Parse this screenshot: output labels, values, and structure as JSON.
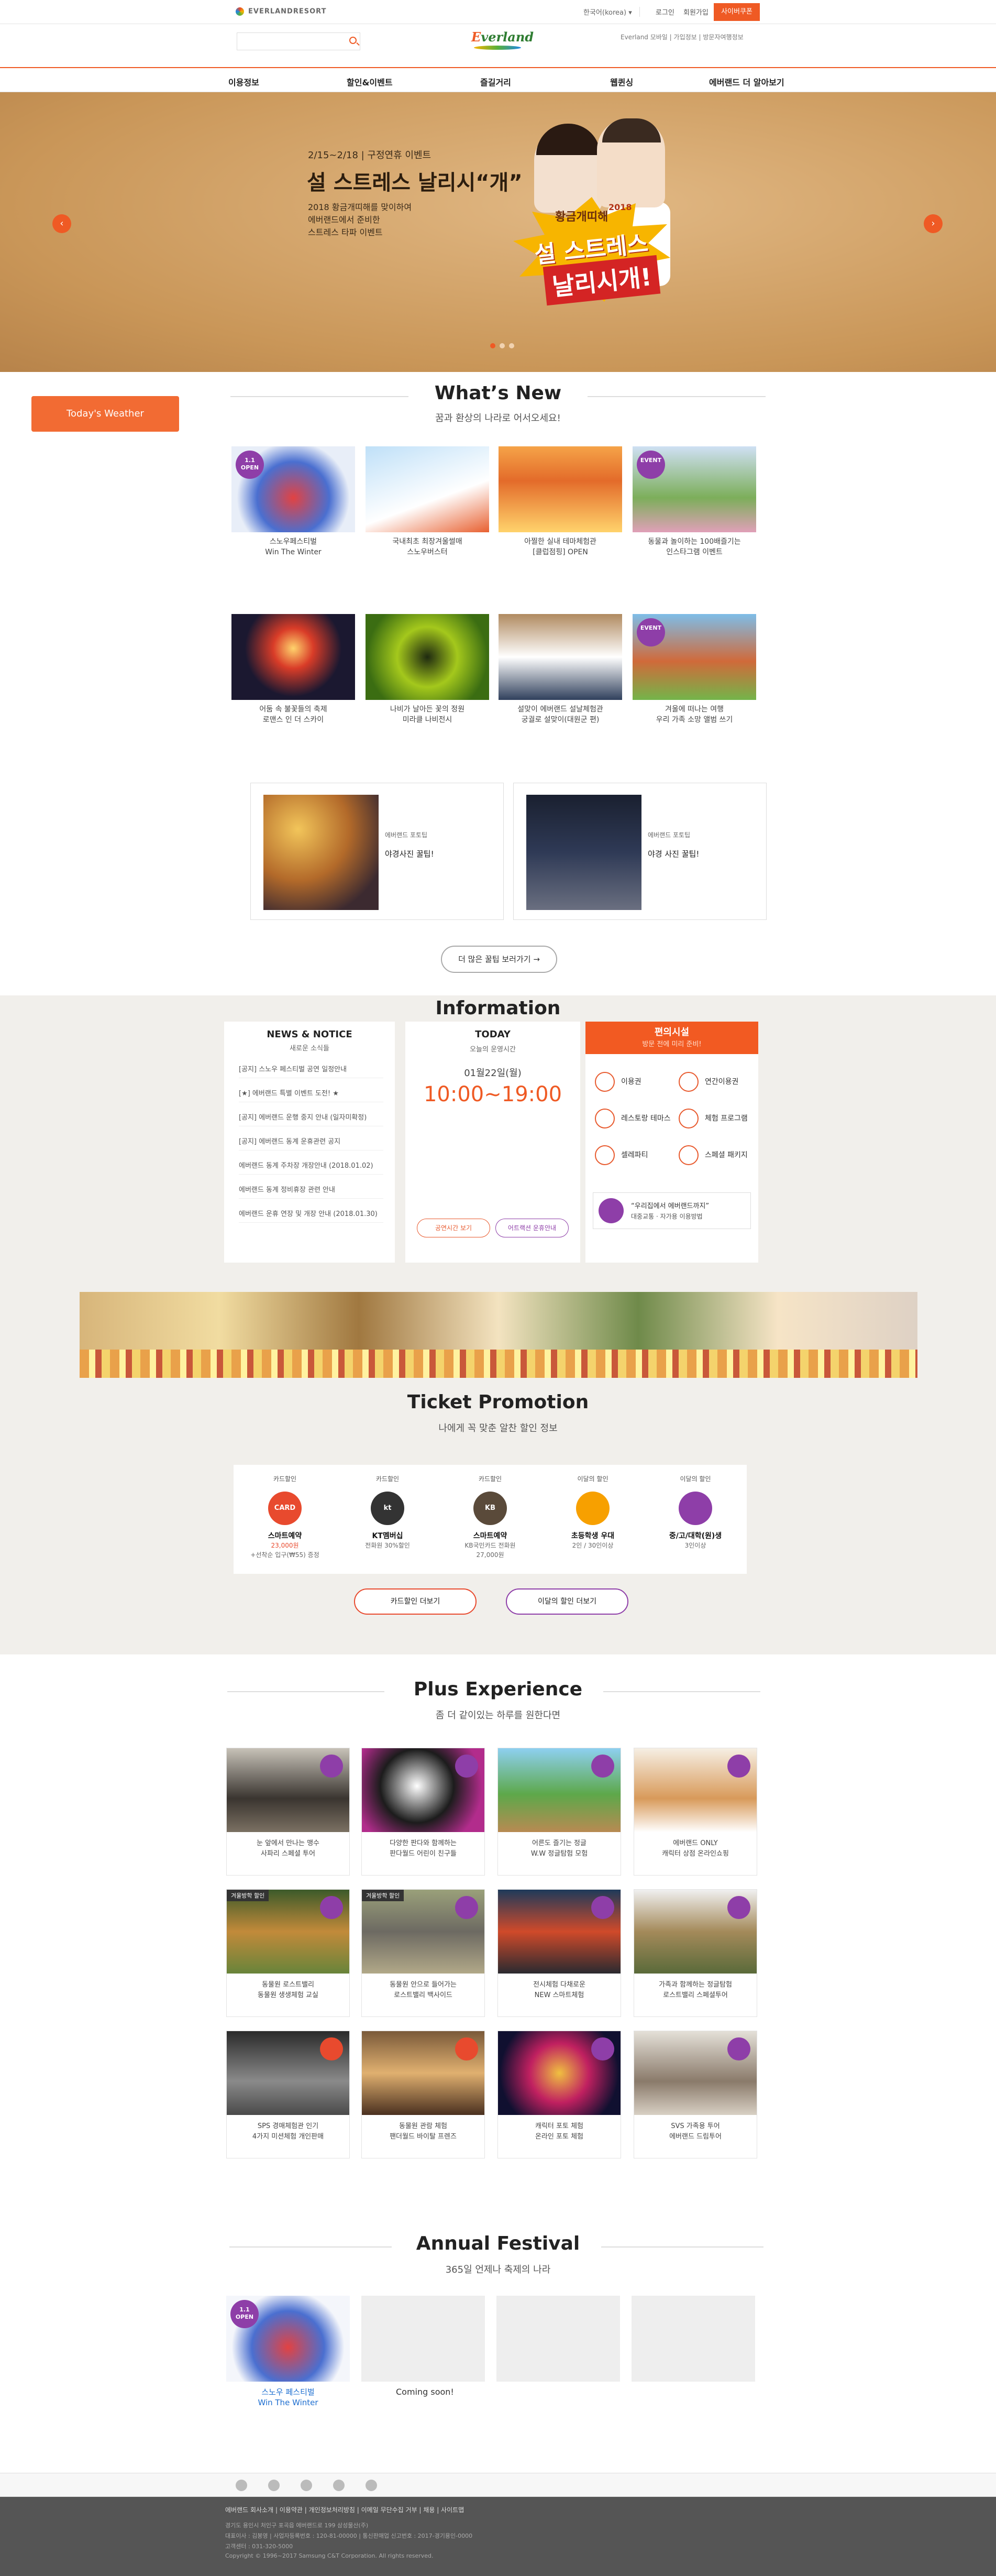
{
  "topbar": {
    "site_logo": "EVERLANDRESORT",
    "language": "한국어(korea)",
    "links": [
      "로그인",
      "회원가입"
    ],
    "cyber_button": "사이버쿠폰"
  },
  "header": {
    "search_placeholder": "",
    "brand": "Everland",
    "right_links": [
      "Everland 모바일",
      "가입정보",
      "방문자여행정보"
    ]
  },
  "nav": [
    "이용정보",
    "할인&이벤트",
    "즐길거리",
    "웹퀸싱",
    "에버랜드 더 알아보기"
  ],
  "hero": {
    "date": "2/15~2/18 | 구정연휴 이벤트",
    "title": "설 스트레스 날리시“개”",
    "desc": [
      "2018 황금개띠해를 맞이하여",
      "에버랜드에서 준비한",
      "스트레스 타파 이벤트"
    ],
    "badge_year": "2018",
    "badge_line1": "황금개띠해",
    "badge_line2": "설 스트레스",
    "badge_line3": "날리시개!",
    "prev": "‹",
    "next": "›"
  },
  "weather_button": "Today's Weather",
  "whats_new": {
    "title": "What’s New",
    "subtitle": "꿈과 환상의 나라로 어서오세요!",
    "items": [
      {
        "cap1": "스노우페스티벌",
        "cap2": "Win The Winter",
        "badge": "1.1 OPEN",
        "badge_color": "#8e3ea8"
      },
      {
        "cap1": "국내최초 최장겨울썰매",
        "cap2": "스노우버스터",
        "badge": "",
        "badge_color": ""
      },
      {
        "cap1": "아찔한 실내 테마체험관",
        "cap2": "[클럽점핑] OPEN",
        "badge": "",
        "badge_color": ""
      },
      {
        "cap1": "동물과 놀이하는 100배즐기는",
        "cap2": "인스타그램 이벤트",
        "badge": "EVENT",
        "badge_color": "#8e3ea8"
      },
      {
        "cap1": "어둠 속 불꽃들의 축제",
        "cap2": "로맨스 인 더 스카이",
        "badge": "",
        "badge_color": ""
      },
      {
        "cap1": "나비가 날아든 꽃의 정원",
        "cap2": "미라클 나비전시",
        "badge": "",
        "badge_color": ""
      },
      {
        "cap1": "설맞이 에버랜드 설날체험관",
        "cap2": "궁궐로 설맞이(대원군 편)",
        "badge": "",
        "badge_color": ""
      },
      {
        "cap1": "겨울에 떠나는 여행",
        "cap2": "우리 가족 소망 앨범 쓰기",
        "badge": "EVENT",
        "badge_color": "#8e3ea8"
      }
    ]
  },
  "tips": {
    "cards": [
      {
        "label": "에버랜드 포토팁",
        "title": "야경사진 꿀팁!"
      },
      {
        "label": "에버랜드 포토팁",
        "title": "야경 사진 꿀팁!"
      }
    ],
    "more": "더 많은 꿀팁 보러가기 →"
  },
  "information": {
    "title": "Information",
    "news_title": "NEWS & NOTICE",
    "news_sub": "새로운 소식들",
    "news": [
      "[공지] 스노우 페스티벌 공연 일정안내",
      "[★] 에버랜드 특별 이벤트 도전! ★",
      "[공지] 에버랜드 운행 중지 안내 (일자미확정)",
      "[공지] 에버랜드 동계 운휴관련 공지",
      "에버랜드 동계 주차장 개장안내 (2018.01.02)",
      "에버랜드 동계 정비휴장 관련 안내",
      "에버랜드 운휴 연장 및 개장 안내 (2018.01.30)"
    ],
    "hours_title": "TODAY",
    "hours_sub": "오늘의 운영시간",
    "date": "01월22일(월)",
    "time": "10:00~19:00",
    "hours_btn1": "공연시간 보기",
    "hours_btn2": "어트랙션 운휴안내",
    "guide_title": "편의시설",
    "guide_sub": "방문 전에 미리 준비!",
    "facilities": [
      "이용권",
      "연간이용권",
      "레스토랑 테마스",
      "체험 프로그램",
      "셀레파티",
      "스페셜 패키지"
    ],
    "route": "“우리집에서 에버랜드까지”",
    "route_sub": "대중교통 · 자가용 이용방법"
  },
  "ticket": {
    "title": "Ticket Promotion",
    "subtitle": "나에게 꼭 맞춘 알찬 할인 정보",
    "items": [
      {
        "kind": "카드할인",
        "name": "스마트예약",
        "desc1": "23,000원",
        "desc2": "+선착순 입구(₩55) 증정",
        "color": "#e84a2e",
        "mark": "CARD"
      },
      {
        "kind": "카드할인",
        "name": "KT멤버십",
        "desc1": "전화원 30%할인",
        "desc2": "",
        "color": "#333333",
        "mark": "kt"
      },
      {
        "kind": "카드할인",
        "name": "스마트예약",
        "desc1": "KB국민카드 전화원",
        "desc2": "27,000원",
        "color": "#5a4a3a",
        "mark": "KB"
      },
      {
        "kind": "이달의 할인",
        "name": "초등학생 우대",
        "desc1": "2인 / 30인이상",
        "desc2": "",
        "color": "#f7a000",
        "mark": ""
      },
      {
        "kind": "이달의 할인",
        "name": "중/고/대학(원)생",
        "desc1": "3인이상",
        "desc2": "",
        "color": "#8e3ea8",
        "mark": ""
      }
    ],
    "btn1": "카드할인 더보기",
    "btn2": "이달의 할인 더보기"
  },
  "plus": {
    "title": "Plus Experience",
    "subtitle": "좀 더 같이있는 하루를 원한다면",
    "items": [
      {
        "cap1": "눈 앞에서 만나는 맹수",
        "cap2": "사파리 스페셜 투어",
        "tag": ""
      },
      {
        "cap1": "다양한 판다와 함께하는",
        "cap2": "판다월드 어린이 친구들",
        "tag": ""
      },
      {
        "cap1": "어른도 즐기는 정글",
        "cap2": "W.W 정글탐험 모험",
        "tag": ""
      },
      {
        "cap1": "에버랜드 ONLY",
        "cap2": "캐릭터 상점 온라인쇼핑",
        "tag": ""
      },
      {
        "cap1": "동물원 로스트밸리",
        "cap2": "동물원 생생체험 교실",
        "tag": "겨울방학 할인"
      },
      {
        "cap1": "동물원 안으로 들어가는",
        "cap2": "로스트밸리 백사이드",
        "tag": "겨울방학 할인"
      },
      {
        "cap1": "전시체험 다채로운",
        "cap2": "NEW 스마트체험",
        "tag": ""
      },
      {
        "cap1": "가족과 함께하는 정글탐험",
        "cap2": "로스트밸리 스페셜투어",
        "tag": ""
      },
      {
        "cap1": "SPS 경매체험관 인기",
        "cap2": "4가지 미션체험 개인판매",
        "tag": ""
      },
      {
        "cap1": "동물원 관람 체험",
        "cap2": "팬더월드 바이탈 프렌즈",
        "tag": ""
      },
      {
        "cap1": "캐릭터 포토 체험",
        "cap2": "온라인 포토 체험",
        "tag": ""
      },
      {
        "cap1": "SVS 가족용 투어",
        "cap2": "에버랜드 드림투어",
        "tag": ""
      }
    ]
  },
  "festival": {
    "title": "Annual Festival",
    "subtitle": "365일 언제나 축제의 나라",
    "items": [
      {
        "cap1": "스노우 페스티벌",
        "cap2": "Win The Winter"
      },
      {
        "cap1": "Coming soon!",
        "cap2": ""
      }
    ]
  },
  "footer": {
    "links": "에버랜드 회사소개 | 이용약관 | 개인정보처리방침 | 이메일 무단수집 거부 | 채용 | 사이트맵",
    "addr1": "경기도 용인시 처인구 포곡읍 에버랜드로 199 삼성물산(주)",
    "addr2": "대표이사 : 김봉영 | 사업자등록번호 : 120-81-00000 | 통신판매업 신고번호 : 2017-경기용인-0000",
    "addr3": "고객센터 : 031-320-5000",
    "copy": "Copyright © 1996~2017 Samsung C&T Corporation. All rights reserved."
  },
  "colors": {
    "accent": "#ef5a24",
    "purple": "#8e3ea8",
    "info_bg": "#f1efeb",
    "footer": "#555555"
  }
}
